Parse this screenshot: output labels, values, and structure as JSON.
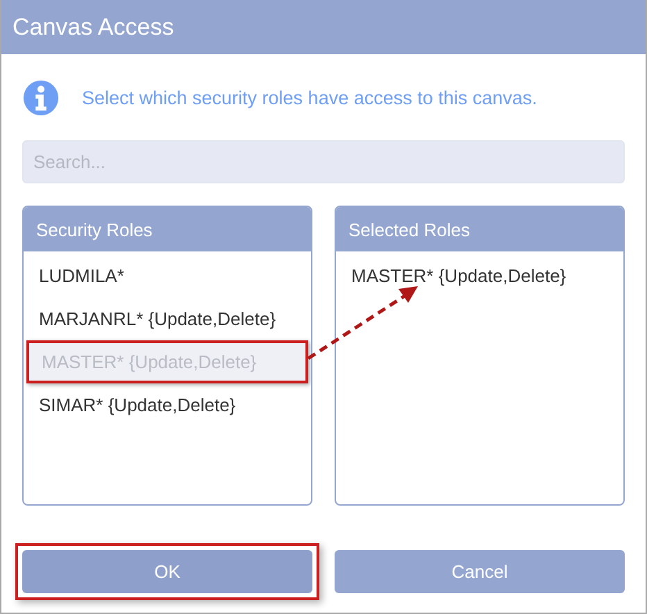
{
  "window": {
    "title": "Canvas Access"
  },
  "info": {
    "message": "Select which security roles have access to this canvas."
  },
  "search": {
    "placeholder": "Search..."
  },
  "panels": [
    {
      "title": "Security Roles",
      "items": [
        {
          "label": "LUDMILA*",
          "selected": false,
          "highlighted": false
        },
        {
          "label": "MARJANRL* {Update,Delete}",
          "selected": false,
          "highlighted": false
        },
        {
          "label": "MASTER* {Update,Delete}",
          "selected": true,
          "highlighted": true
        },
        {
          "label": "SIMAR* {Update,Delete}",
          "selected": false,
          "highlighted": false
        }
      ]
    },
    {
      "title": "Selected Roles",
      "items": [
        {
          "label": "MASTER* {Update,Delete}",
          "selected": false,
          "highlighted": false
        }
      ]
    }
  ],
  "move_arrow": true,
  "buttons": [
    {
      "label": "OK",
      "highlighted": true
    },
    {
      "label": "Cancel",
      "highlighted": false
    }
  ]
}
